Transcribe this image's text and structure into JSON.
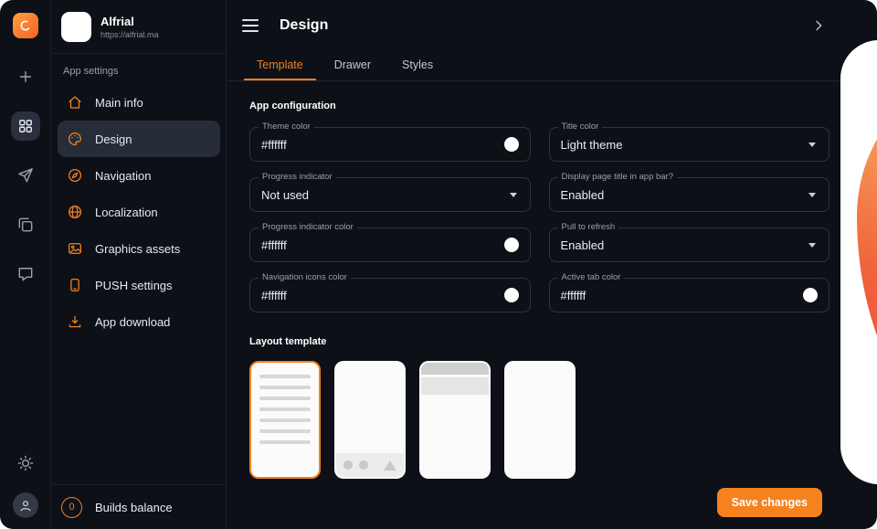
{
  "colors": {
    "accent": "#f5821f",
    "background": "#0d1017"
  },
  "rail": {
    "top_icons": [
      "plus-icon",
      "apps-grid-icon",
      "send-icon",
      "assets-icon",
      "chat-icon"
    ],
    "active_icon": "apps-grid-icon",
    "bottom_icons": [
      "theme-toggle-icon",
      "user-avatar-icon"
    ]
  },
  "sidebar": {
    "app_name": "Alfrial",
    "app_url": "https://alfrial.ma",
    "section_label": "App settings",
    "items": [
      {
        "label": "Main info",
        "icon": "home-icon",
        "active": false
      },
      {
        "label": "Design",
        "icon": "palette-icon",
        "active": true
      },
      {
        "label": "Navigation",
        "icon": "compass-icon",
        "active": false
      },
      {
        "label": "Localization",
        "icon": "globe-icon",
        "active": false
      },
      {
        "label": "Graphics assets",
        "icon": "image-icon",
        "active": false
      },
      {
        "label": "PUSH settings",
        "icon": "phone-notification-icon",
        "active": false
      },
      {
        "label": "App download",
        "icon": "download-icon",
        "active": false
      }
    ],
    "footer": {
      "badge": "0",
      "label": "Builds balance"
    }
  },
  "header": {
    "title": "Design"
  },
  "tabs": [
    {
      "label": "Template",
      "active": true
    },
    {
      "label": "Drawer",
      "active": false
    },
    {
      "label": "Styles",
      "active": false
    }
  ],
  "app_configuration": {
    "section_title": "App configuration",
    "fields": [
      {
        "label": "Theme color",
        "value": "#ffffff",
        "type": "color"
      },
      {
        "label": "Title color",
        "value": "Light theme",
        "type": "select"
      },
      {
        "label": "Progress indicator",
        "value": "Not used",
        "type": "select"
      },
      {
        "label": "Display page title in app bar?",
        "value": "Enabled",
        "type": "select"
      },
      {
        "label": "Progress indicator color",
        "value": "#ffffff",
        "type": "color"
      },
      {
        "label": "Pull to refresh",
        "value": "Enabled",
        "type": "select"
      },
      {
        "label": "Navigation icons color",
        "value": "#ffffff",
        "type": "color"
      },
      {
        "label": "Active tab color",
        "value": "#ffffff",
        "type": "color"
      }
    ]
  },
  "layout_template": {
    "section_title": "Layout template",
    "options": [
      {
        "name": "list",
        "selected": true
      },
      {
        "name": "media-footer",
        "selected": false
      },
      {
        "name": "header",
        "selected": false
      },
      {
        "name": "blank",
        "selected": false
      }
    ]
  },
  "footer": {
    "save_label": "Save changes"
  }
}
